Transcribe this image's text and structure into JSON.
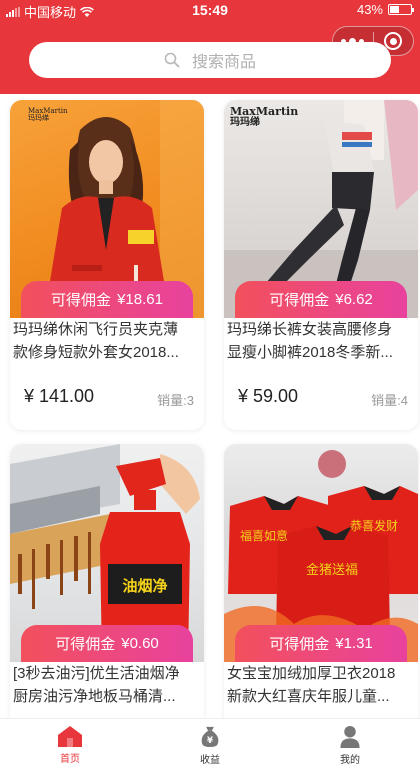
{
  "status_bar": {
    "carrier": "中国移动",
    "time": "15:49",
    "battery": "43%",
    "battery_level": 0.43
  },
  "search": {
    "placeholder": "搜索商品"
  },
  "products": [
    {
      "commission_label": "可得佣金",
      "commission": "¥18.61",
      "title_line1": "玛玛绨休闲飞行员夹克薄",
      "title_line2": "款修身短款外套女2018...",
      "price": "¥ 141.00",
      "sales": "销量:3",
      "brand_en": "MaxMartin",
      "brand_cn": "玛玛绨"
    },
    {
      "commission_label": "可得佣金",
      "commission": "¥6.62",
      "title_line1": "玛玛绨长裤女装高腰修身",
      "title_line2": "显瘦小脚裤2018冬季新...",
      "price": "¥ 59.00",
      "sales": "销量:4",
      "brand_en": "MaxMartin",
      "brand_cn": "玛玛绨"
    },
    {
      "commission_label": "可得佣金",
      "commission": "¥0.60",
      "title_line1": "[3秒去油污]优生活油烟净",
      "title_line2": "厨房油污净地板马桶清...",
      "price": "",
      "sales": "",
      "bottle_label": "油烟净"
    },
    {
      "commission_label": "可得佣金",
      "commission": "¥1.31",
      "title_line1": "女宝宝加绒加厚卫衣2018",
      "title_line2": "新款大红喜庆年服儿童...",
      "price": "",
      "sales": "",
      "shirt_texts": [
        "福喜如意",
        "恭喜发财",
        "金猪送福"
      ]
    }
  ],
  "tabbar": [
    {
      "label": "首页",
      "icon": "home-icon",
      "active": true
    },
    {
      "label": "收益",
      "icon": "money-bag-icon",
      "active": false
    },
    {
      "label": "我的",
      "icon": "user-icon",
      "active": false
    }
  ],
  "colors": {
    "brand_red": "#e8373c",
    "commission_gradient_start": "#f2505c",
    "commission_gradient_end": "#e8429e"
  }
}
